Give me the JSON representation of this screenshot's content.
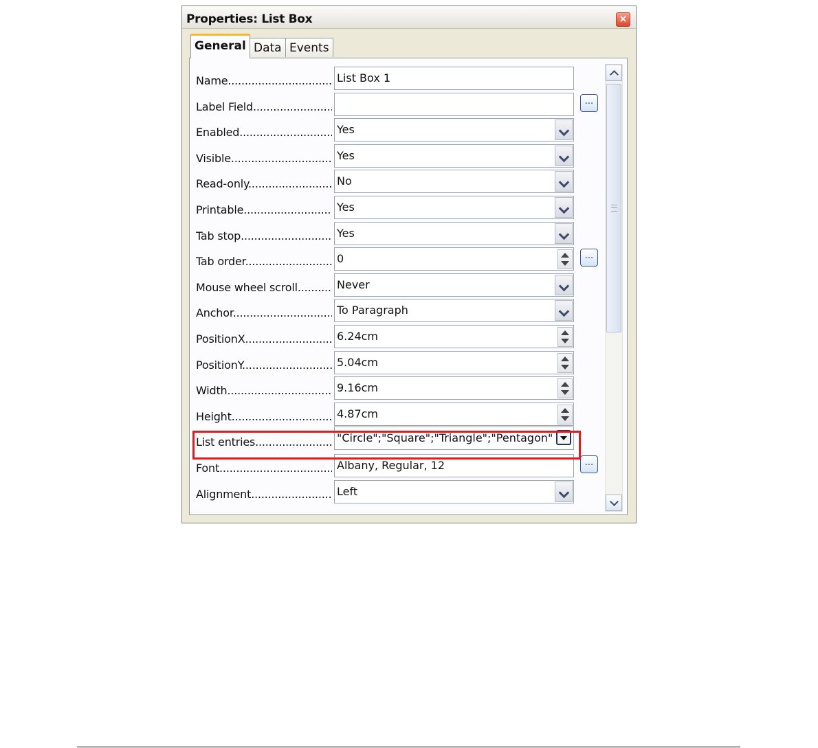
{
  "dialog": {
    "title": "Properties: List Box",
    "close_label": "×"
  },
  "tabs": [
    {
      "label": "General",
      "active": true
    },
    {
      "label": "Data",
      "active": false
    },
    {
      "label": "Events",
      "active": false
    }
  ],
  "properties": [
    {
      "label": "Name",
      "value": "List Box 1",
      "control": "text"
    },
    {
      "label": "Label Field",
      "value": "",
      "control": "text",
      "ellipsis": true
    },
    {
      "label": "Enabled",
      "value": "Yes",
      "control": "dropdown"
    },
    {
      "label": "Visible",
      "value": "Yes",
      "control": "dropdown"
    },
    {
      "label": "Read-only",
      "value": "No",
      "control": "dropdown"
    },
    {
      "label": "Printable",
      "value": "Yes",
      "control": "dropdown"
    },
    {
      "label": "Tab stop",
      "value": "Yes",
      "control": "dropdown"
    },
    {
      "label": "Tab order",
      "value": "0",
      "control": "spin",
      "ellipsis": true
    },
    {
      "label": "Mouse wheel scroll",
      "value": "Never",
      "control": "dropdown"
    },
    {
      "label": "Anchor",
      "value": "To Paragraph",
      "control": "dropdown"
    },
    {
      "label": "PositionX",
      "value": "6.24cm",
      "control": "spin"
    },
    {
      "label": "PositionY",
      "value": "5.04cm",
      "control": "spin"
    },
    {
      "label": "Width",
      "value": "9.16cm",
      "control": "spin"
    },
    {
      "label": "Height",
      "value": "4.87cm",
      "control": "spin"
    },
    {
      "label": "List entries",
      "value": "\"Circle\";\"Square\";\"Triangle\";\"Pentagon\"",
      "control": "list",
      "highlighted": true
    },
    {
      "label": "Font",
      "value": "Albany, Regular, 12",
      "control": "text",
      "ellipsis": true
    },
    {
      "label": "Alignment",
      "value": "Left",
      "control": "dropdown"
    }
  ],
  "ellipsis_label": "...",
  "colors": {
    "highlight": "#e21c1c",
    "active_tab_accent": "#f5b830"
  }
}
